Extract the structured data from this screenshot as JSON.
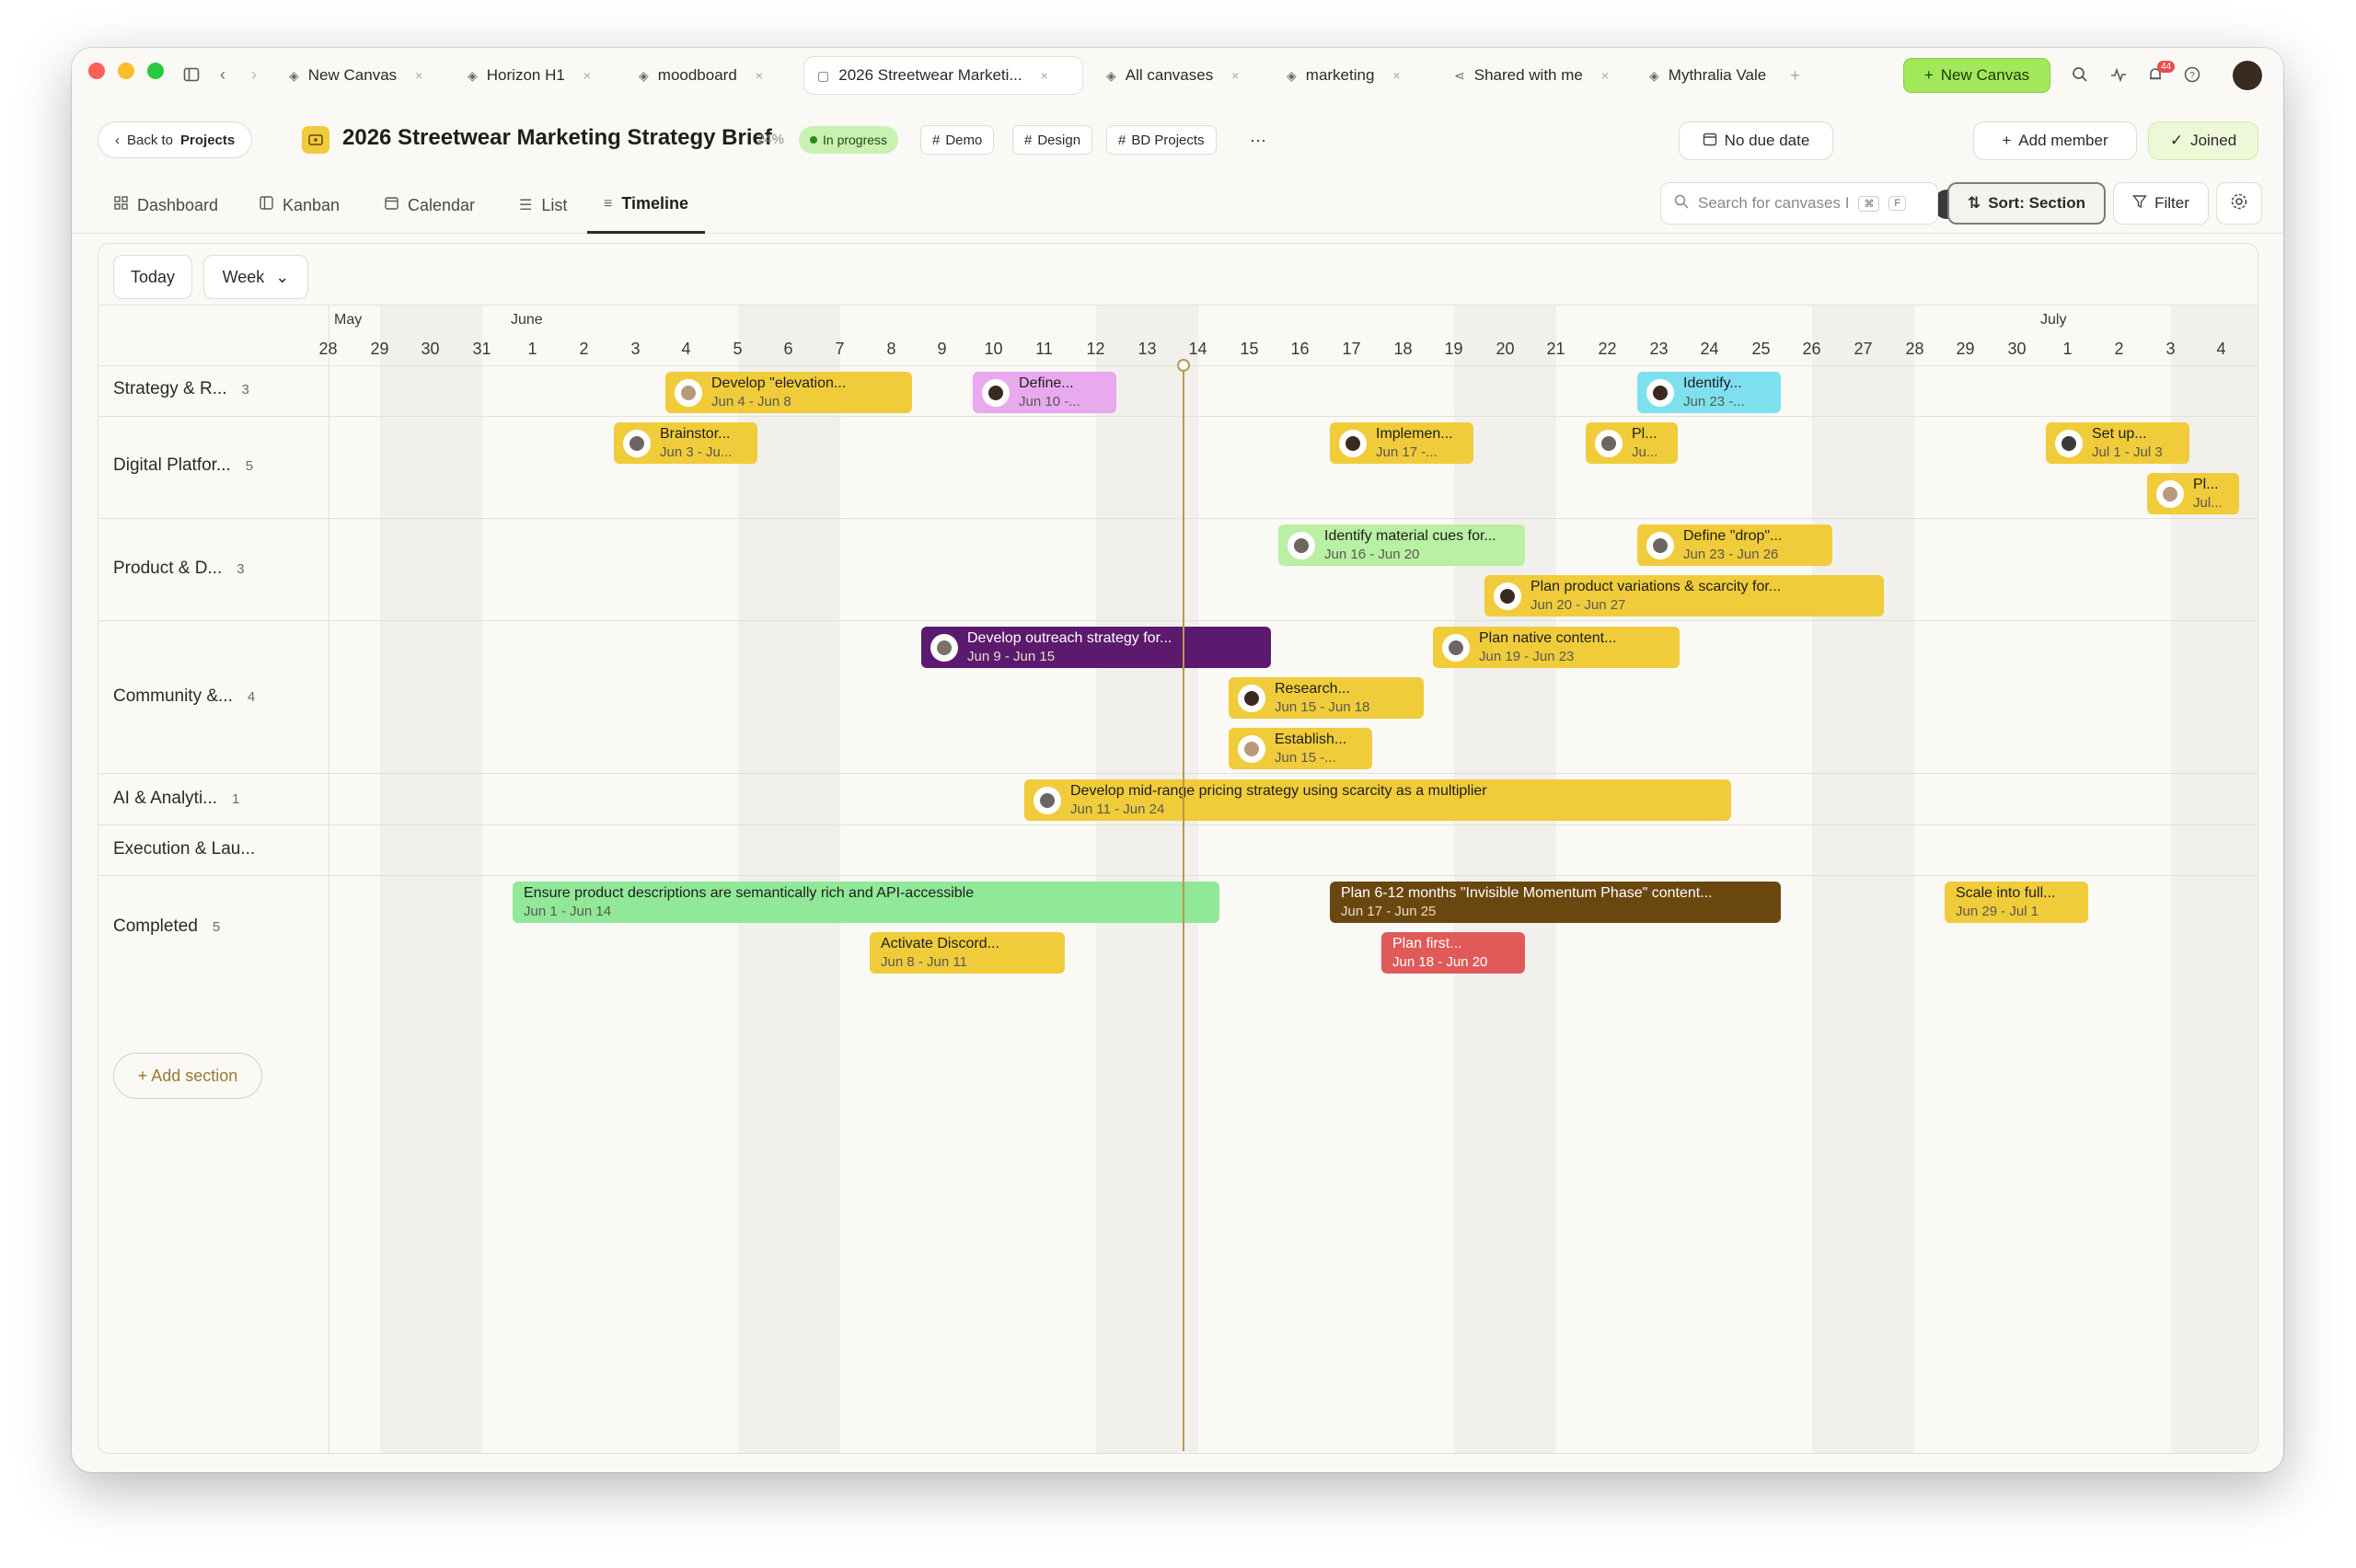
{
  "window": {
    "tabs": [
      {
        "label": "New Canvas",
        "icon": "layers-icon"
      },
      {
        "label": "Horizon H1",
        "icon": "layers-icon"
      },
      {
        "label": "moodboard",
        "icon": "layers-icon"
      },
      {
        "label": "2026 Streetwear Marketi...",
        "icon": "canvas-icon",
        "active": true
      },
      {
        "label": "All canvases",
        "icon": "layers-icon"
      },
      {
        "label": "marketing",
        "icon": "layers-icon"
      },
      {
        "label": "Shared with me",
        "icon": "share-icon"
      },
      {
        "label": "Mythralia Vale",
        "icon": "layers-icon"
      }
    ],
    "new_canvas_label": "New Canvas",
    "notification_count": "44"
  },
  "project": {
    "back_label": "Back to",
    "back_target": "Projects",
    "title": "2026 Streetwear Marketing Strategy Brief",
    "progress": "24%",
    "status": "In progress",
    "tags": [
      "Demo",
      "Design",
      "BD Projects"
    ],
    "more": "···",
    "due_date": "No due date",
    "add_member": "Add member",
    "joined": "Joined"
  },
  "views": {
    "tabs": [
      "Dashboard",
      "Kanban",
      "Calendar",
      "List",
      "Timeline"
    ],
    "active": "Timeline",
    "search_placeholder": "Search for canvases I",
    "shortcut": [
      "⌘",
      "F"
    ],
    "sort_label": "Sort: Section",
    "filter_label": "Filter"
  },
  "timeline": {
    "today_label": "Today",
    "scale_label": "Week",
    "months": [
      "May",
      "June",
      "July"
    ],
    "days": [
      "28",
      "29",
      "30",
      "31",
      "1",
      "2",
      "3",
      "4",
      "5",
      "6",
      "7",
      "8",
      "9",
      "10",
      "11",
      "12",
      "13",
      "14",
      "15",
      "16",
      "17",
      "18",
      "19",
      "20",
      "21",
      "22",
      "23",
      "24",
      "25",
      "26",
      "27",
      "28",
      "29",
      "30",
      "1",
      "2",
      "3",
      "4"
    ],
    "today": "Jun 14",
    "sections": [
      {
        "name": "Strategy & R...",
        "count": "3"
      },
      {
        "name": "Digital Platfor...",
        "count": "5"
      },
      {
        "name": "Product & D...",
        "count": "3"
      },
      {
        "name": "Community &...",
        "count": "4"
      },
      {
        "name": "AI & Analyti...",
        "count": "1"
      },
      {
        "name": "Execution & Lau...",
        "count": ""
      },
      {
        "name": "Completed",
        "count": "5"
      }
    ],
    "add_section_label": "+ Add section",
    "tasks": [
      {
        "section": 0,
        "name": "Develop \"elevation...",
        "dates": "Jun 4 - Jun 8",
        "color": "#f0cc3b"
      },
      {
        "section": 0,
        "name": "Define...",
        "dates": "Jun 10 -...",
        "color": "#e8a9ee"
      },
      {
        "section": 0,
        "name": "Identify...",
        "dates": "Jun 23 -...",
        "color": "#7ee0ef"
      },
      {
        "section": 1,
        "name": "Brainstor...",
        "dates": "Jun 3 - Ju...",
        "color": "#f0cc3b"
      },
      {
        "section": 1,
        "name": "Implemen...",
        "dates": "Jun 17 -...",
        "color": "#f0cc3b"
      },
      {
        "section": 1,
        "name": "Pl...",
        "dates": "Ju...",
        "color": "#f0cc3b"
      },
      {
        "section": 1,
        "name": "Set up...",
        "dates": "Jul 1 - Jul 3",
        "color": "#f0cc3b"
      },
      {
        "section": 1,
        "name": "Pl...",
        "dates": "Jul...",
        "color": "#f0cc3b"
      },
      {
        "section": 2,
        "name": "Identify material cues for...",
        "dates": "Jun 16 - Jun 20",
        "color": "#b8f0a4"
      },
      {
        "section": 2,
        "name": "Define \"drop\"...",
        "dates": "Jun 23 - Jun 26",
        "color": "#f0cc3b"
      },
      {
        "section": 2,
        "name": "Plan product variations & scarcity for...",
        "dates": "Jun 20 - Jun 27",
        "color": "#f0cc3b"
      },
      {
        "section": 3,
        "name": "Develop outreach strategy for...",
        "dates": "Jun 9 - Jun 15",
        "color": "#5c1a6e"
      },
      {
        "section": 3,
        "name": "Plan native content...",
        "dates": "Jun 19 - Jun 23",
        "color": "#f0cc3b"
      },
      {
        "section": 3,
        "name": "Research...",
        "dates": "Jun 15 - Jun 18",
        "color": "#f0cc3b"
      },
      {
        "section": 3,
        "name": "Establish...",
        "dates": "Jun 15 -...",
        "color": "#f0cc3b"
      },
      {
        "section": 4,
        "name": "Develop mid-range pricing strategy using scarcity as a multiplier",
        "dates": "Jun 11 - Jun 24",
        "color": "#f0cc3b"
      },
      {
        "section": 6,
        "name": "Ensure product descriptions are semantically rich and API-accessible",
        "dates": "Jun 1 - Jun 14",
        "color": "#90e898"
      },
      {
        "section": 6,
        "name": "Plan 6-12 months \"Invisible Momentum Phase\" content...",
        "dates": "Jun 17 - Jun 25",
        "color": "#6b4710"
      },
      {
        "section": 6,
        "name": "Scale into full...",
        "dates": "Jun 29 - Jul 1",
        "color": "#f0cc3b"
      },
      {
        "section": 6,
        "name": "Activate Discord...",
        "dates": "Jun 8 - Jun 11",
        "color": "#f0cc3b"
      },
      {
        "section": 6,
        "name": "Plan first...",
        "dates": "Jun 18 - Jun 20",
        "color": "#e05a5a"
      }
    ]
  }
}
